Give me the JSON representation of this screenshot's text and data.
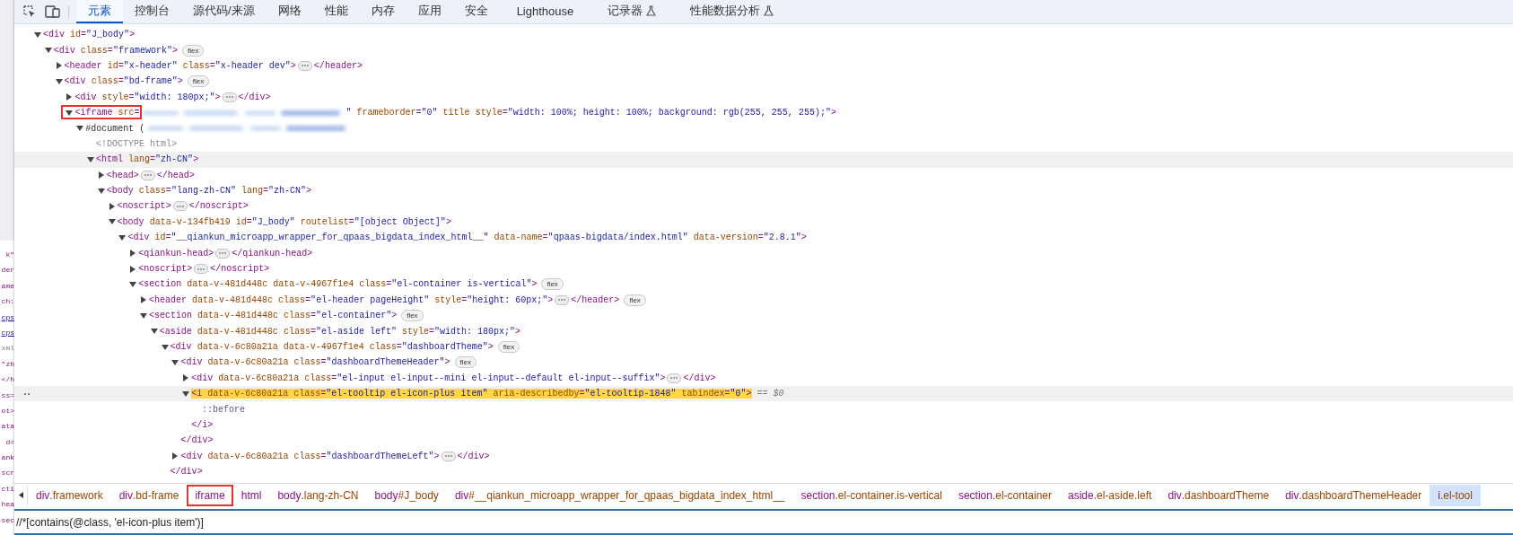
{
  "tabs": [
    {
      "label": "元素",
      "selected": true,
      "experimental": false
    },
    {
      "label": "控制台",
      "selected": false,
      "experimental": false
    },
    {
      "label": "源代码/来源",
      "selected": false,
      "experimental": false
    },
    {
      "label": "网络",
      "selected": false,
      "experimental": false
    },
    {
      "label": "性能",
      "selected": false,
      "experimental": false
    },
    {
      "label": "内存",
      "selected": false,
      "experimental": false
    },
    {
      "label": "应用",
      "selected": false,
      "experimental": false
    },
    {
      "label": "安全",
      "selected": false,
      "experimental": false
    },
    {
      "label": "Lighthouse",
      "selected": false,
      "experimental": false
    },
    {
      "label": "记录器",
      "selected": false,
      "experimental": true
    },
    {
      "label": "性能数据分析",
      "selected": false,
      "experimental": true
    }
  ],
  "left_pane_fragments": [
    "k\"",
    "der",
    "ame",
    "ch:",
    "cps",
    "cps",
    "xml",
    "\"zh",
    "</h",
    "ss=",
    "ot>",
    "ata",
    "d=",
    "ank",
    "scr",
    "cti",
    "hea",
    "sec"
  ],
  "tree": [
    {
      "kind": "element",
      "open": "<div id=\"J_body\">",
      "expanded": true,
      "selected": false,
      "hovered": false,
      "annotated": false,
      "redacted": false,
      "children": [
        {
          "kind": "element",
          "open": "<div class=\"framework\">",
          "badge": "flex",
          "expanded": true,
          "selected": false,
          "hovered": false,
          "annotated": false,
          "redacted": false,
          "children": [
            {
              "kind": "element",
              "open": "<header id=\"x-header\" class=\"x-header dev\">",
              "close": "</header>",
              "expanded": false,
              "selected": false,
              "hovered": false,
              "annotated": false,
              "redacted": false
            },
            {
              "kind": "element",
              "open": "<div class=\"bd-frame\">",
              "badge": "flex",
              "expanded": true,
              "selected": false,
              "hovered": false,
              "annotated": false,
              "redacted": false,
              "children": [
                {
                  "kind": "element",
                  "open": "<div style=\"width: 180px;\">",
                  "close": "</div>",
                  "expanded": false,
                  "selected": false,
                  "hovered": false,
                  "annotated": false,
                  "redacted": false
                },
                {
                  "kind": "element",
                  "open": "<iframe src=",
                  "after": "\" frameborder=\"0\" title style=\"width: 100%; height: 100%; background: rgb(255, 255, 255);\">",
                  "expanded": true,
                  "selected": false,
                  "hovered": false,
                  "annotated": true,
                  "redacted": true,
                  "children": [
                    {
                      "kind": "document",
                      "open": "#document (",
                      "expanded": true,
                      "selected": false,
                      "hovered": false,
                      "annotated": false,
                      "redacted": true,
                      "children": [
                        {
                          "kind": "doctype",
                          "open": "<!DOCTYPE html>",
                          "selected": false,
                          "hovered": false,
                          "annotated": false,
                          "redacted": false
                        },
                        {
                          "kind": "element",
                          "open": "<html lang=\"zh-CN\">",
                          "expanded": true,
                          "selected": false,
                          "hovered": true,
                          "annotated": false,
                          "redacted": false,
                          "children": [
                            {
                              "kind": "element",
                              "open": "<head>",
                              "close": "</head>",
                              "expanded": false,
                              "selected": false,
                              "hovered": false,
                              "annotated": false,
                              "redacted": false
                            },
                            {
                              "kind": "element",
                              "open": "<body class=\"lang-zh-CN\" lang=\"zh-CN\">",
                              "expanded": true,
                              "selected": false,
                              "hovered": false,
                              "annotated": false,
                              "redacted": false,
                              "children": [
                                {
                                  "kind": "element",
                                  "open": "<noscript>",
                                  "close": "</noscript>",
                                  "expanded": false,
                                  "selected": false,
                                  "hovered": false,
                                  "annotated": false,
                                  "redacted": false
                                },
                                {
                                  "kind": "element",
                                  "open": "<body data-v-134fb419 id=\"J_body\" routelist=\"[object Object]\">",
                                  "expanded": true,
                                  "selected": false,
                                  "hovered": false,
                                  "annotated": false,
                                  "redacted": false,
                                  "children": [
                                    {
                                      "kind": "element",
                                      "open": "<div id=\"__qiankun_microapp_wrapper_for_qpaas_bigdata_index_html__\" data-name=\"qpaas-bigdata/index.html\" data-version=\"2.8.1\">",
                                      "expanded": true,
                                      "selected": false,
                                      "hovered": false,
                                      "annotated": false,
                                      "redacted": false,
                                      "children": [
                                        {
                                          "kind": "element",
                                          "open": "<qiankun-head>",
                                          "close": "</qiankun-head>",
                                          "expanded": false,
                                          "selected": false,
                                          "hovered": false,
                                          "annotated": false,
                                          "redacted": false
                                        },
                                        {
                                          "kind": "element",
                                          "open": "<noscript>",
                                          "close": "</noscript>",
                                          "expanded": false,
                                          "selected": false,
                                          "hovered": false,
                                          "annotated": false,
                                          "redacted": false
                                        },
                                        {
                                          "kind": "element",
                                          "open": "<section data-v-481d448c data-v-4967f1e4 class=\"el-container is-vertical\">",
                                          "badge": "flex",
                                          "expanded": true,
                                          "selected": false,
                                          "hovered": false,
                                          "annotated": false,
                                          "redacted": false,
                                          "children": [
                                            {
                                              "kind": "element",
                                              "open": "<header data-v-481d448c class=\"el-header pageHeight\" style=\"height: 60px;\">",
                                              "close": "</header>",
                                              "badge": "flex",
                                              "expanded": false,
                                              "selected": false,
                                              "hovered": false,
                                              "annotated": false,
                                              "redacted": false
                                            },
                                            {
                                              "kind": "element",
                                              "open": "<section data-v-481d448c class=\"el-container\">",
                                              "badge": "flex",
                                              "expanded": true,
                                              "selected": false,
                                              "hovered": false,
                                              "annotated": false,
                                              "redacted": false,
                                              "children": [
                                                {
                                                  "kind": "element",
                                                  "open": "<aside data-v-481d448c class=\"el-aside left\" style=\"width: 180px;\">",
                                                  "expanded": true,
                                                  "selected": false,
                                                  "hovered": false,
                                                  "annotated": false,
                                                  "redacted": false,
                                                  "children": [
                                                    {
                                                      "kind": "element",
                                                      "open": "<div data-v-6c80a21a data-v-4967f1e4 class=\"dashboardTheme\">",
                                                      "close": "</div>",
                                                      "badge": "flex",
                                                      "expanded": true,
                                                      "selected": false,
                                                      "hovered": false,
                                                      "annotated": false,
                                                      "redacted": false,
                                                      "children": [
                                                        {
                                                          "kind": "element",
                                                          "open": "<div data-v-6c80a21a class=\"dashboardThemeHeader\">",
                                                          "close": "</div>",
                                                          "badge": "flex",
                                                          "expanded": true,
                                                          "selected": false,
                                                          "hovered": false,
                                                          "annotated": false,
                                                          "redacted": false,
                                                          "children": [
                                                            {
                                                              "kind": "element",
                                                              "open": "<div data-v-6c80a21a class=\"el-input el-input--mini el-input--default el-input--suffix\">",
                                                              "close": "</div>",
                                                              "expanded": false,
                                                              "selected": false,
                                                              "hovered": false,
                                                              "annotated": false,
                                                              "redacted": false
                                                            },
                                                            {
                                                              "kind": "element",
                                                              "open": "<i data-v-6c80a21a class=\"el-tooltip el-icon-plus item\" aria-describedby=\"el-tooltip-1848\" tabindex=\"0\">",
                                                              "close": "</i>",
                                                              "console_ref": "== $0",
                                                              "expanded": true,
                                                              "selected": true,
                                                              "hovered": false,
                                                              "annotated": false,
                                                              "redacted": false,
                                                              "children": [
                                                                {
                                                                  "kind": "pseudo",
                                                                  "open": "::before",
                                                                  "selected": false,
                                                                  "hovered": false,
                                                                  "annotated": false,
                                                                  "redacted": false
                                                                }
                                                              ]
                                                            }
                                                          ]
                                                        },
                                                        {
                                                          "kind": "element",
                                                          "open": "<div data-v-6c80a21a class=\"dashboardThemeLeft\">",
                                                          "close": "</div>",
                                                          "expanded": false,
                                                          "selected": false,
                                                          "hovered": false,
                                                          "annotated": false,
                                                          "redacted": false
                                                        }
                                                      ]
                                                    }
                                                  ]
                                                }
                                              ]
                                            }
                                          ]
                                        }
                                      ]
                                    }
                                  ]
                                }
                              ]
                            }
                          ]
                        }
                      ]
                    }
                  ]
                }
              ]
            }
          ]
        }
      ]
    }
  ],
  "breadcrumbs": [
    {
      "label": "div.framework",
      "selected": false,
      "annotated": false
    },
    {
      "label": "div.bd-frame",
      "selected": false,
      "annotated": false
    },
    {
      "label": "iframe",
      "selected": false,
      "annotated": true
    },
    {
      "label": "html",
      "selected": false,
      "annotated": false
    },
    {
      "label": "body.lang-zh-CN",
      "selected": false,
      "annotated": false
    },
    {
      "label": "body#J_body",
      "selected": false,
      "annotated": false
    },
    {
      "label": "div#__qiankun_microapp_wrapper_for_qpaas_bigdata_index_html__",
      "selected": false,
      "annotated": false
    },
    {
      "label": "section.el-container.is-vertical",
      "selected": false,
      "annotated": false
    },
    {
      "label": "section.el-container",
      "selected": false,
      "annotated": false
    },
    {
      "label": "aside.el-aside.left",
      "selected": false,
      "annotated": false
    },
    {
      "label": "div.dashboardTheme",
      "selected": false,
      "annotated": false
    },
    {
      "label": "div.dashboardThemeHeader",
      "selected": false,
      "annotated": false
    },
    {
      "label": "i.el-tool",
      "selected": true,
      "annotated": false
    }
  ],
  "search": {
    "value": "//*[contains(@class, 'el-icon-plus item')]"
  }
}
